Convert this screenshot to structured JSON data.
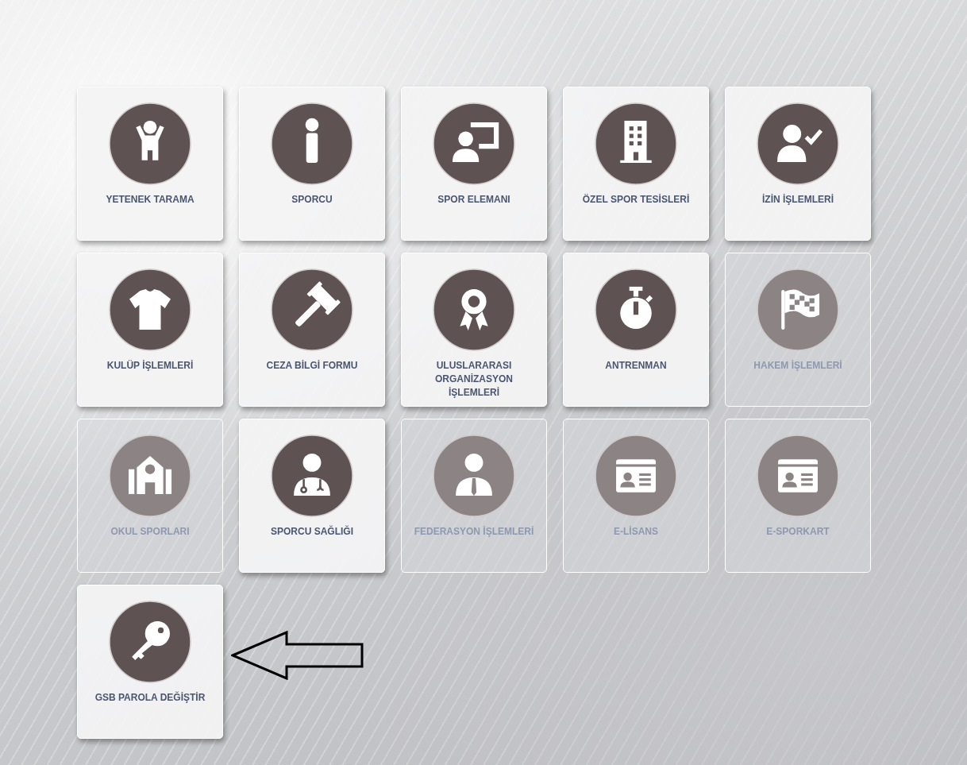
{
  "tiles": [
    {
      "label": "YETENEK TARAMA",
      "kind": "child",
      "disabled": false
    },
    {
      "label": "SPORCU",
      "kind": "person",
      "disabled": false
    },
    {
      "label": "SPOR ELEMANI",
      "kind": "presenter",
      "disabled": false
    },
    {
      "label": "ÖZEL SPOR TESİSLERİ",
      "kind": "building",
      "disabled": false
    },
    {
      "label": "İZİN İŞLEMLERİ",
      "kind": "usercheck",
      "disabled": false
    },
    {
      "label": "KULÜP İŞLEMLERİ",
      "kind": "shirt",
      "disabled": false
    },
    {
      "label": "CEZA BİLGİ FORMU",
      "kind": "gavel",
      "disabled": false
    },
    {
      "label": "ULUSLARARASI ORGANİZASYON İŞLEMLERİ",
      "kind": "award",
      "disabled": false
    },
    {
      "label": "ANTRENMAN",
      "kind": "stopwatch",
      "disabled": false
    },
    {
      "label": "HAKEM İŞLEMLERİ",
      "kind": "flag",
      "disabled": true
    },
    {
      "label": "OKUL SPORLARI",
      "kind": "school",
      "disabled": true
    },
    {
      "label": "SPORCU SAĞLIĞI",
      "kind": "doctor",
      "disabled": false
    },
    {
      "label": "FEDERASYON İŞLEMLERİ",
      "kind": "businessman",
      "disabled": true
    },
    {
      "label": "E-LİSANS",
      "kind": "idcard",
      "disabled": true
    },
    {
      "label": "E-SPORKART",
      "kind": "idcard",
      "disabled": true
    },
    {
      "label": "GSB PAROLA DEĞİŞTİR",
      "kind": "key",
      "disabled": false
    }
  ]
}
